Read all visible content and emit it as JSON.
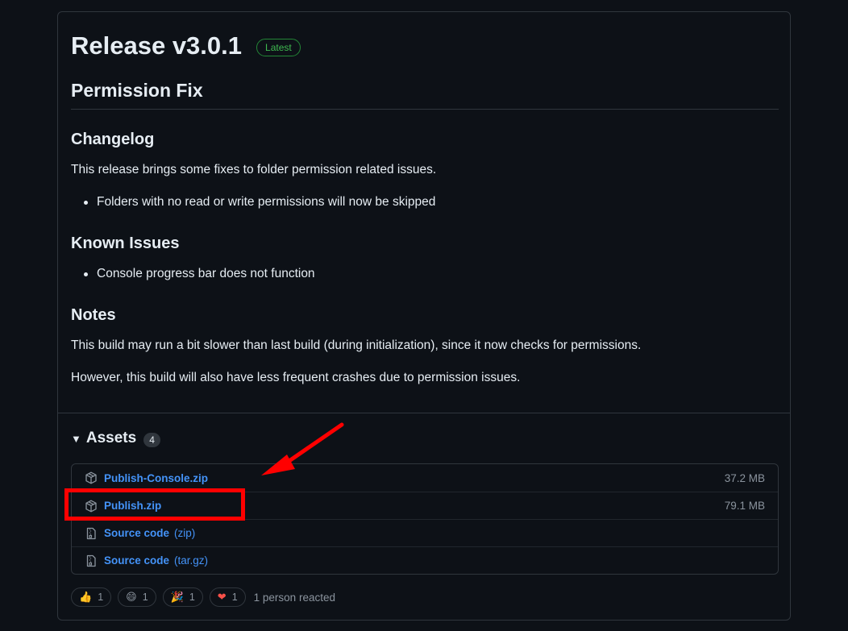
{
  "release": {
    "title": "Release v3.0.1",
    "badge": "Latest",
    "subtitle": "Permission Fix",
    "changelog_heading": "Changelog",
    "changelog_text": "This release brings some fixes to folder permission related issues.",
    "changelog_bullets": [
      "Folders with no read or write permissions will now be skipped"
    ],
    "known_issues_heading": "Known Issues",
    "known_issues_bullets": [
      "Console progress bar does not function"
    ],
    "notes_heading": "Notes",
    "notes_paragraphs": [
      "This build may run a bit slower than last build (during initialization), since it now checks for permissions.",
      "However, this build will also have less frequent crashes due to permission issues."
    ]
  },
  "assets": {
    "title": "Assets",
    "count": "4",
    "items": [
      {
        "name": "Publish-Console.zip",
        "ext": "",
        "size": "37.2 MB",
        "icon": "package-icon"
      },
      {
        "name": "Publish.zip",
        "ext": "",
        "size": "79.1 MB",
        "icon": "package-icon"
      },
      {
        "name": "Source code",
        "ext": "(zip)",
        "size": "",
        "icon": "file-zip-icon"
      },
      {
        "name": "Source code",
        "ext": "(tar.gz)",
        "size": "",
        "icon": "file-zip-icon"
      }
    ]
  },
  "reactions": {
    "items": [
      {
        "emoji": "👍",
        "count": "1",
        "icon": "thumbs-up-icon"
      },
      {
        "emoji": "😄",
        "count": "1",
        "icon": "smile-icon"
      },
      {
        "emoji": "🎉",
        "count": "1",
        "icon": "tada-icon"
      },
      {
        "emoji": "❤",
        "count": "1",
        "icon": "heart-icon"
      }
    ],
    "summary": "1 person reacted"
  },
  "colors": {
    "background": "#0d1117",
    "border": "#30363d",
    "link": "#4493f8",
    "badge_green": "#3fb950",
    "annotation_red": "#ff0000"
  }
}
